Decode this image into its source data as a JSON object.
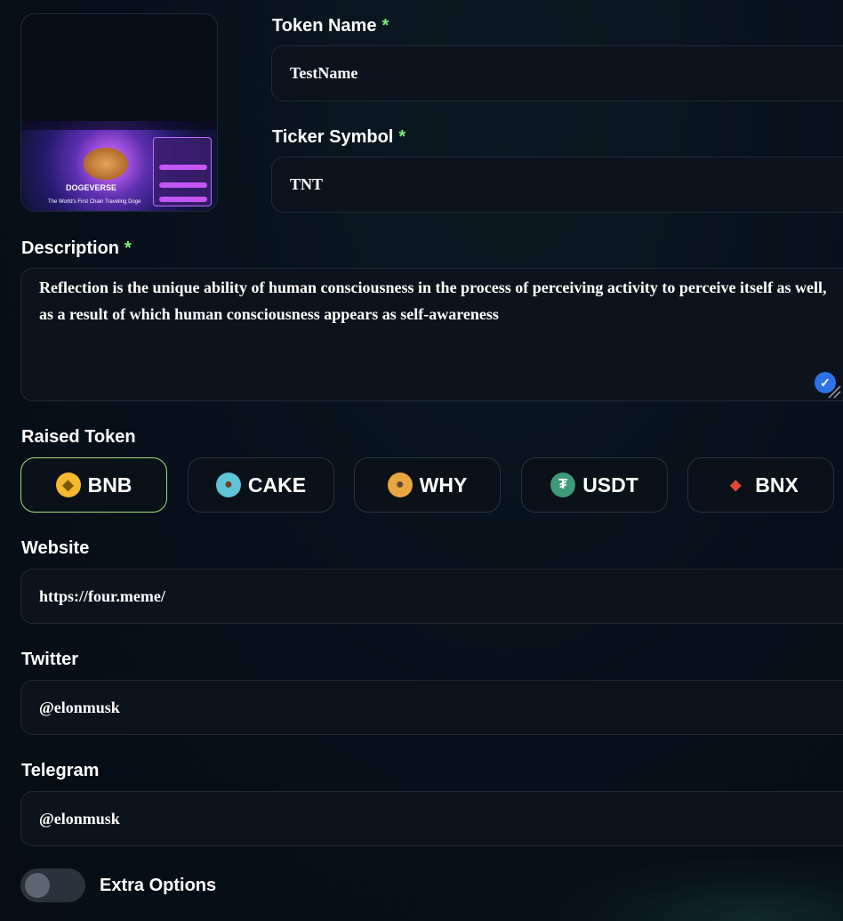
{
  "form": {
    "token_name": {
      "label": "Token Name",
      "required_mark": "*",
      "value": "TestName"
    },
    "ticker_symbol": {
      "label": "Ticker Symbol",
      "required_mark": "*",
      "value": "TNT"
    },
    "description": {
      "label": "Description",
      "required_mark": "*",
      "value": "Reflection is the unique ability of human consciousness in the process of perceiving activity to perceive itself as well, as a result of which human consciousness appears as self-awareness"
    },
    "raised_token": {
      "label": "Raised Token",
      "selected": "BNB",
      "options": [
        {
          "label": "BNB",
          "icon": "bnb-icon",
          "color": "#f3ba2f"
        },
        {
          "label": "CAKE",
          "icon": "cake-icon",
          "color": "#5fc4d6"
        },
        {
          "label": "WHY",
          "icon": "why-icon",
          "color": "#e8a640"
        },
        {
          "label": "USDT",
          "icon": "usdt-icon",
          "color": "#3e9a7a"
        },
        {
          "label": "BNX",
          "icon": "bnx-icon",
          "color": "#e0463a"
        }
      ]
    },
    "website": {
      "label": "Website",
      "value": "https://four.meme/"
    },
    "twitter": {
      "label": "Twitter",
      "value": "@elonmusk"
    },
    "telegram": {
      "label": "Telegram",
      "value": "@elonmusk"
    },
    "extra_options": {
      "label": "Extra Options",
      "enabled": false
    }
  },
  "image_preview": {
    "brand": "DOGEVERSE",
    "tagline": "The World's First Chain Traveling Doge"
  },
  "colors": {
    "accent_required": "#7cf07a",
    "selected_border": "#9be07f",
    "field_bg": "#0c131c",
    "page_bg": "#07101a"
  }
}
